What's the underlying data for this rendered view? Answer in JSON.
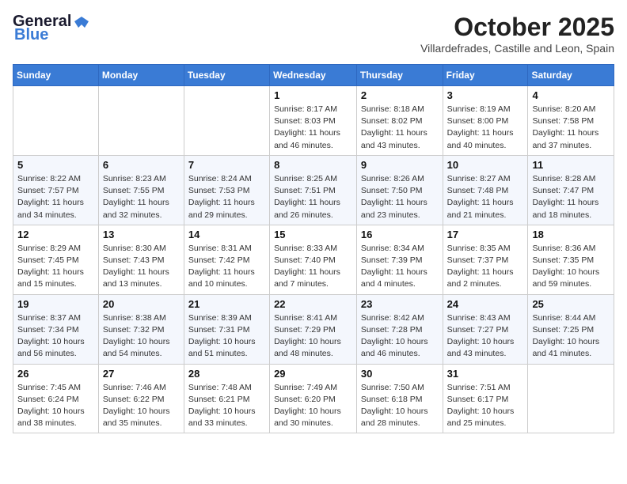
{
  "header": {
    "logo_general": "General",
    "logo_blue": "Blue",
    "month": "October 2025",
    "location": "Villardefrades, Castille and Leon, Spain"
  },
  "days_of_week": [
    "Sunday",
    "Monday",
    "Tuesday",
    "Wednesday",
    "Thursday",
    "Friday",
    "Saturday"
  ],
  "weeks": [
    [
      {
        "day": "",
        "info": ""
      },
      {
        "day": "",
        "info": ""
      },
      {
        "day": "",
        "info": ""
      },
      {
        "day": "1",
        "info": "Sunrise: 8:17 AM\nSunset: 8:03 PM\nDaylight: 11 hours and 46 minutes."
      },
      {
        "day": "2",
        "info": "Sunrise: 8:18 AM\nSunset: 8:02 PM\nDaylight: 11 hours and 43 minutes."
      },
      {
        "day": "3",
        "info": "Sunrise: 8:19 AM\nSunset: 8:00 PM\nDaylight: 11 hours and 40 minutes."
      },
      {
        "day": "4",
        "info": "Sunrise: 8:20 AM\nSunset: 7:58 PM\nDaylight: 11 hours and 37 minutes."
      }
    ],
    [
      {
        "day": "5",
        "info": "Sunrise: 8:22 AM\nSunset: 7:57 PM\nDaylight: 11 hours and 34 minutes."
      },
      {
        "day": "6",
        "info": "Sunrise: 8:23 AM\nSunset: 7:55 PM\nDaylight: 11 hours and 32 minutes."
      },
      {
        "day": "7",
        "info": "Sunrise: 8:24 AM\nSunset: 7:53 PM\nDaylight: 11 hours and 29 minutes."
      },
      {
        "day": "8",
        "info": "Sunrise: 8:25 AM\nSunset: 7:51 PM\nDaylight: 11 hours and 26 minutes."
      },
      {
        "day": "9",
        "info": "Sunrise: 8:26 AM\nSunset: 7:50 PM\nDaylight: 11 hours and 23 minutes."
      },
      {
        "day": "10",
        "info": "Sunrise: 8:27 AM\nSunset: 7:48 PM\nDaylight: 11 hours and 21 minutes."
      },
      {
        "day": "11",
        "info": "Sunrise: 8:28 AM\nSunset: 7:47 PM\nDaylight: 11 hours and 18 minutes."
      }
    ],
    [
      {
        "day": "12",
        "info": "Sunrise: 8:29 AM\nSunset: 7:45 PM\nDaylight: 11 hours and 15 minutes."
      },
      {
        "day": "13",
        "info": "Sunrise: 8:30 AM\nSunset: 7:43 PM\nDaylight: 11 hours and 13 minutes."
      },
      {
        "day": "14",
        "info": "Sunrise: 8:31 AM\nSunset: 7:42 PM\nDaylight: 11 hours and 10 minutes."
      },
      {
        "day": "15",
        "info": "Sunrise: 8:33 AM\nSunset: 7:40 PM\nDaylight: 11 hours and 7 minutes."
      },
      {
        "day": "16",
        "info": "Sunrise: 8:34 AM\nSunset: 7:39 PM\nDaylight: 11 hours and 4 minutes."
      },
      {
        "day": "17",
        "info": "Sunrise: 8:35 AM\nSunset: 7:37 PM\nDaylight: 11 hours and 2 minutes."
      },
      {
        "day": "18",
        "info": "Sunrise: 8:36 AM\nSunset: 7:35 PM\nDaylight: 10 hours and 59 minutes."
      }
    ],
    [
      {
        "day": "19",
        "info": "Sunrise: 8:37 AM\nSunset: 7:34 PM\nDaylight: 10 hours and 56 minutes."
      },
      {
        "day": "20",
        "info": "Sunrise: 8:38 AM\nSunset: 7:32 PM\nDaylight: 10 hours and 54 minutes."
      },
      {
        "day": "21",
        "info": "Sunrise: 8:39 AM\nSunset: 7:31 PM\nDaylight: 10 hours and 51 minutes."
      },
      {
        "day": "22",
        "info": "Sunrise: 8:41 AM\nSunset: 7:29 PM\nDaylight: 10 hours and 48 minutes."
      },
      {
        "day": "23",
        "info": "Sunrise: 8:42 AM\nSunset: 7:28 PM\nDaylight: 10 hours and 46 minutes."
      },
      {
        "day": "24",
        "info": "Sunrise: 8:43 AM\nSunset: 7:27 PM\nDaylight: 10 hours and 43 minutes."
      },
      {
        "day": "25",
        "info": "Sunrise: 8:44 AM\nSunset: 7:25 PM\nDaylight: 10 hours and 41 minutes."
      }
    ],
    [
      {
        "day": "26",
        "info": "Sunrise: 7:45 AM\nSunset: 6:24 PM\nDaylight: 10 hours and 38 minutes."
      },
      {
        "day": "27",
        "info": "Sunrise: 7:46 AM\nSunset: 6:22 PM\nDaylight: 10 hours and 35 minutes."
      },
      {
        "day": "28",
        "info": "Sunrise: 7:48 AM\nSunset: 6:21 PM\nDaylight: 10 hours and 33 minutes."
      },
      {
        "day": "29",
        "info": "Sunrise: 7:49 AM\nSunset: 6:20 PM\nDaylight: 10 hours and 30 minutes."
      },
      {
        "day": "30",
        "info": "Sunrise: 7:50 AM\nSunset: 6:18 PM\nDaylight: 10 hours and 28 minutes."
      },
      {
        "day": "31",
        "info": "Sunrise: 7:51 AM\nSunset: 6:17 PM\nDaylight: 10 hours and 25 minutes."
      },
      {
        "day": "",
        "info": ""
      }
    ]
  ]
}
